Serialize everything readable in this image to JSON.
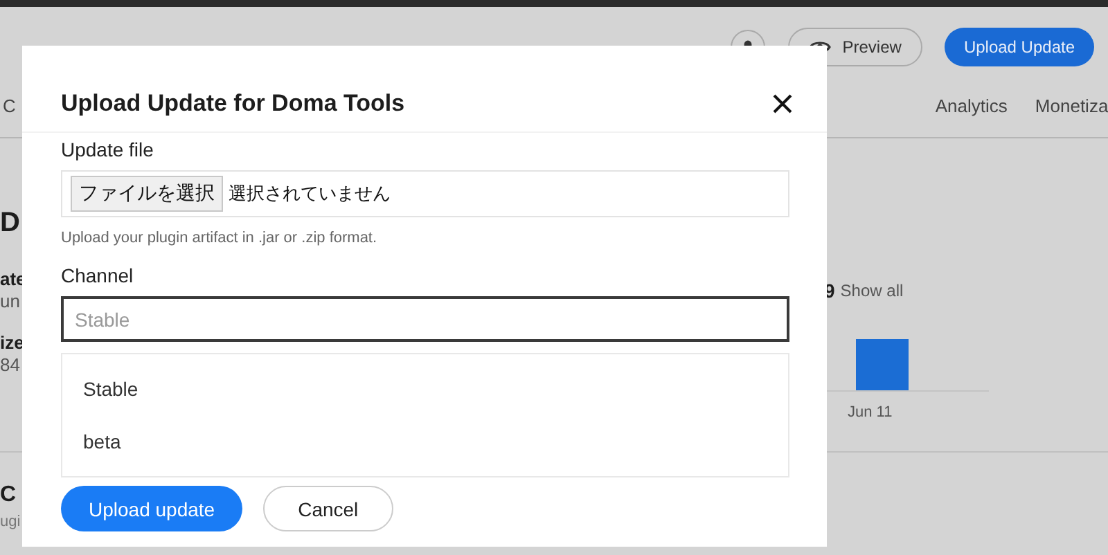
{
  "page": {
    "actions": {
      "preview": "Preview",
      "upload": "Upload Update"
    },
    "tabs": [
      {
        "label": "C",
        "selected": false
      },
      {
        "label": "Analytics",
        "selected": false
      },
      {
        "label": "Monetiza",
        "selected": false
      }
    ],
    "heading": "D",
    "details": [
      {
        "label": "ate",
        "value": "un"
      },
      {
        "label": "ize",
        "value": "84"
      }
    ],
    "stat": {
      "value": "9",
      "link": "Show all"
    },
    "chart_label": "Jun 11",
    "section": {
      "title": "C",
      "text": "ugi"
    }
  },
  "dialog": {
    "title": "Upload Update for Doma Tools",
    "file_field": {
      "label": "Update file",
      "button": "ファイルを選択",
      "status": "選択されていません",
      "hint": "Upload your plugin artifact in .jar or .zip format."
    },
    "channel": {
      "label": "Channel",
      "placeholder": "Stable",
      "options": [
        {
          "label": "Stable",
          "selected": false
        },
        {
          "label": "beta",
          "selected": false
        }
      ]
    },
    "buttons": [
      {
        "label": "Upload update",
        "kind": "primary"
      },
      {
        "label": "Cancel",
        "kind": "secondary"
      }
    ]
  }
}
